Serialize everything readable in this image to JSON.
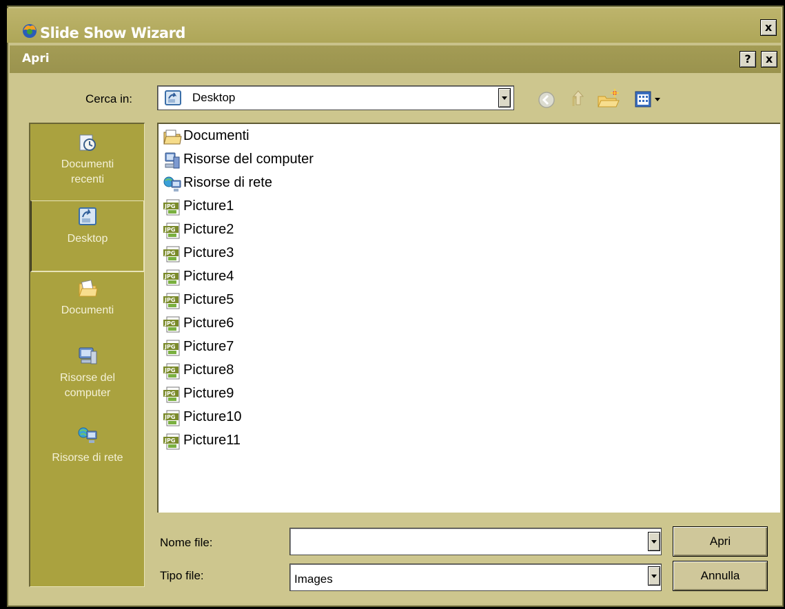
{
  "wizard": {
    "title": "Slide Show Wizard",
    "close_label": "x"
  },
  "dialog": {
    "title": "Apri",
    "help_label": "?",
    "close_label": "x",
    "look_in": {
      "label": "Cerca in:",
      "value": "Desktop"
    },
    "places": [
      {
        "label_lines": [
          "Documenti",
          "recenti"
        ],
        "icon": "recent-documents-icon"
      },
      {
        "label_lines": [
          "Desktop"
        ],
        "icon": "desktop-icon",
        "selected": true
      },
      {
        "label_lines": [
          "Documenti"
        ],
        "icon": "my-documents-icon"
      },
      {
        "label_lines": [
          "Risorse del",
          "computer"
        ],
        "icon": "my-computer-icon"
      },
      {
        "label_lines": [
          "Risorse di rete"
        ],
        "icon": "network-places-icon"
      }
    ],
    "files": [
      {
        "name": "Documenti",
        "icon": "folder-icon"
      },
      {
        "name": "Risorse del computer",
        "icon": "computer-icon"
      },
      {
        "name": "Risorse di rete",
        "icon": "network-icon"
      },
      {
        "name": "Picture1",
        "icon": "jpg-file-icon"
      },
      {
        "name": "Picture2",
        "icon": "jpg-file-icon"
      },
      {
        "name": "Picture3",
        "icon": "jpg-file-icon"
      },
      {
        "name": "Picture4",
        "icon": "jpg-file-icon"
      },
      {
        "name": "Picture5",
        "icon": "jpg-file-icon"
      },
      {
        "name": "Picture6",
        "icon": "jpg-file-icon"
      },
      {
        "name": "Picture7",
        "icon": "jpg-file-icon"
      },
      {
        "name": "Picture8",
        "icon": "jpg-file-icon"
      },
      {
        "name": "Picture9",
        "icon": "jpg-file-icon"
      },
      {
        "name": "Picture10",
        "icon": "jpg-file-icon"
      },
      {
        "name": "Picture11",
        "icon": "jpg-file-icon"
      }
    ],
    "file_name": {
      "label": "Nome file:",
      "value": ""
    },
    "file_type": {
      "label": "Tipo file:",
      "value": "Images"
    },
    "buttons": {
      "open": "Apri",
      "cancel": "Annulla"
    }
  },
  "colors": {
    "title_bar": "#aea658",
    "dialog_bg": "#cdc68e",
    "places_bg": "#aaa23f"
  }
}
